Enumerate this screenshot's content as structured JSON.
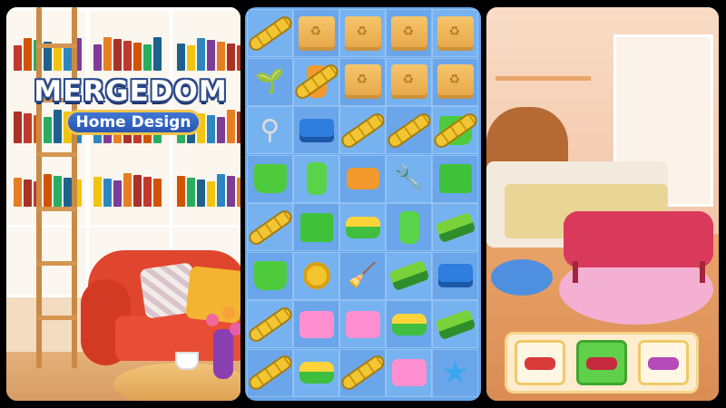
{
  "logo": {
    "main": "MERGEDOM",
    "subtitle": "Home Design"
  },
  "board": {
    "rows": [
      [
        "chain",
        "box",
        "box",
        "box",
        "box"
      ],
      [
        "sprout",
        "bottle-chain",
        "box",
        "box",
        "box"
      ],
      [
        "corkscrew",
        "toolbox",
        "chain",
        "chain",
        "bucket-chain"
      ],
      [
        "bucket",
        "spray-bottle",
        "soap",
        "wrench",
        "dustpan"
      ],
      [
        "chain",
        "dustpan",
        "sponge",
        "spray-bottle",
        "brush"
      ],
      [
        "bucket",
        "coin",
        "broom",
        "brush",
        "toolbox"
      ],
      [
        "chain",
        "tub",
        "tub",
        "sponge",
        "brush"
      ],
      [
        "chain",
        "sponge",
        "chain",
        "tub",
        "star"
      ]
    ]
  },
  "colors": {
    "board_bg": "#6aa7ea",
    "accent_gold": "#f1c44d",
    "logo_blue": "#2a55b0",
    "selected_green": "#5fd04a"
  },
  "furniture_choices": [
    {
      "icon": "red-chaise-icon",
      "color": "#d93a3a",
      "selected": false
    },
    {
      "icon": "red-bench-icon",
      "color": "#c42a3c",
      "selected": true
    },
    {
      "icon": "purple-daybed-icon",
      "color": "#b44ab8",
      "selected": false
    }
  ]
}
